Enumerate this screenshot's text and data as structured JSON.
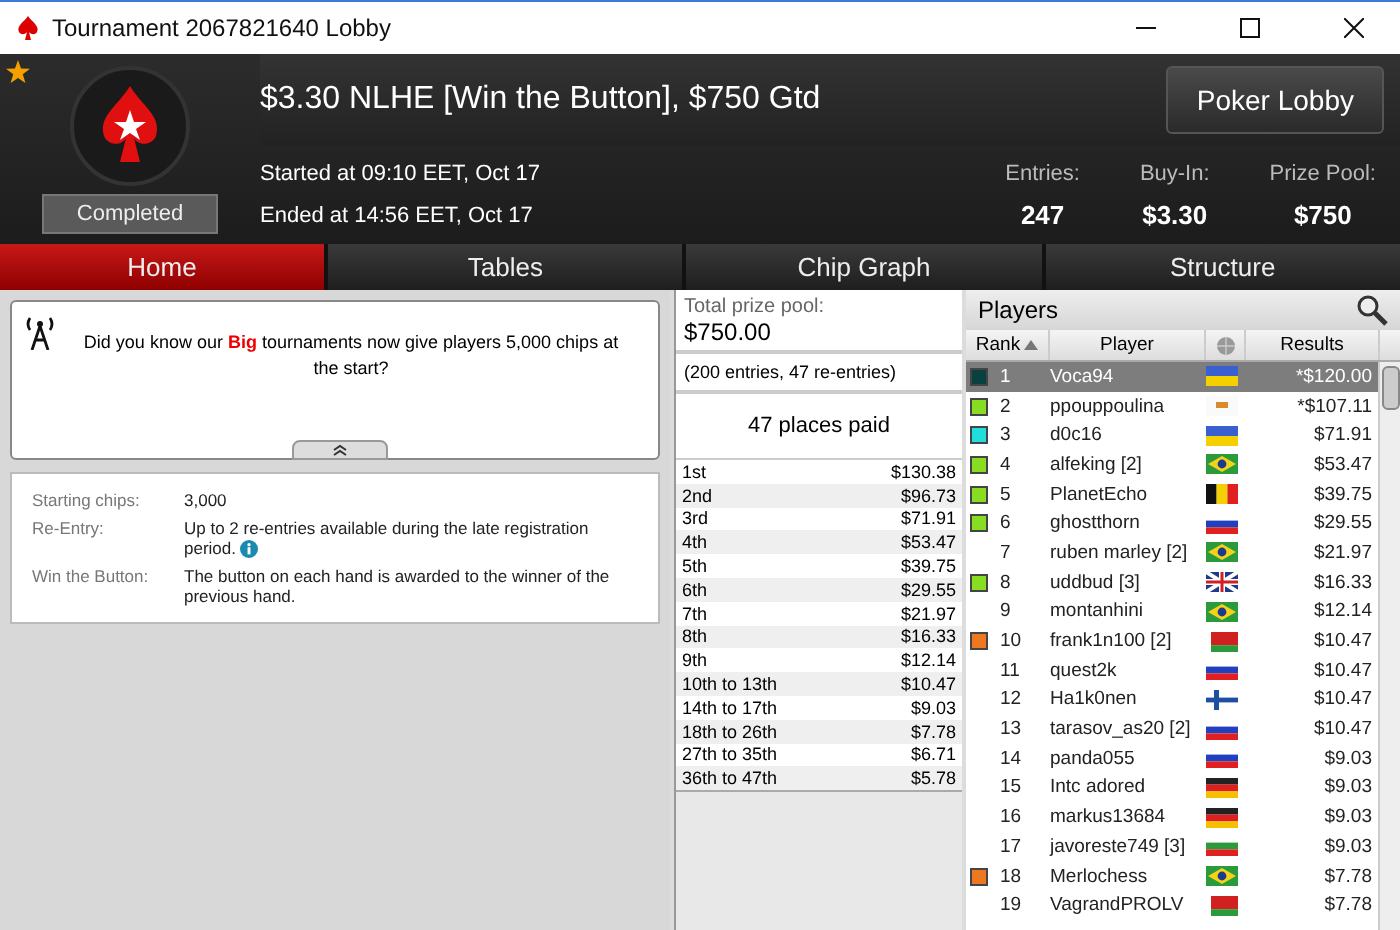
{
  "window": {
    "title": "Tournament 2067821640 Lobby"
  },
  "header": {
    "favorite": true,
    "title": "$3.30 NLHE [Win the Button], $750 Gtd",
    "status": "Completed",
    "started": "Started at 09:10 EET, Oct 17",
    "ended": "Ended at 14:56 EET, Oct 17",
    "stats": [
      {
        "label": "Entries:",
        "value": "247"
      },
      {
        "label": "Buy-In:",
        "value": "$3.30"
      },
      {
        "label": "Prize Pool:",
        "value": "$750"
      }
    ],
    "lobby_button": "Poker Lobby"
  },
  "tabs": [
    {
      "label": "Home",
      "selected": true
    },
    {
      "label": "Tables",
      "selected": false
    },
    {
      "label": "Chip Graph",
      "selected": false
    },
    {
      "label": "Structure",
      "selected": false
    }
  ],
  "news": "Did you know our **Big** tournaments now give players 5,000 chips at the start?",
  "details": [
    {
      "label": "Starting chips:",
      "value": "3,000",
      "info": false
    },
    {
      "label": "Re-Entry:",
      "value": "Up to 2 re-entries available during the late registration period.",
      "info": true
    },
    {
      "label": "Win the Button:",
      "value": "The button on each hand is awarded to the winner of the previous hand.",
      "info": false
    }
  ],
  "prize": {
    "label": "Total prize pool:",
    "total": "$750.00",
    "entries": "(200 entries, 47 re-entries)",
    "paid": "47 places paid",
    "places": [
      {
        "place": "1st",
        "amount": "$130.38"
      },
      {
        "place": "2nd",
        "amount": "$96.73"
      },
      {
        "place": "3rd",
        "amount": "$71.91"
      },
      {
        "place": "4th",
        "amount": "$53.47"
      },
      {
        "place": "5th",
        "amount": "$39.75"
      },
      {
        "place": "6th",
        "amount": "$29.55"
      },
      {
        "place": "7th",
        "amount": "$21.97"
      },
      {
        "place": "8th",
        "amount": "$16.33"
      },
      {
        "place": "9th",
        "amount": "$12.14"
      },
      {
        "place": "10th to 13th",
        "amount": "$10.47"
      },
      {
        "place": "14th to 17th",
        "amount": "$9.03"
      },
      {
        "place": "18th to 26th",
        "amount": "$7.78"
      },
      {
        "place": "27th to 35th",
        "amount": "$6.71"
      },
      {
        "place": "36th to 47th",
        "amount": "$5.78"
      }
    ]
  },
  "players": {
    "title": "Players",
    "columns": [
      "Rank",
      "Player",
      "Results"
    ],
    "rows": [
      {
        "rank": "1",
        "name": "Voca94",
        "kind": "ukraine",
        "result": "*$120.00",
        "color": "#0b4040",
        "selected": true
      },
      {
        "rank": "2",
        "name": "ppouppoulina",
        "kind": "cyprus",
        "result": "*$107.11",
        "color": "#88dd22",
        "selected": false
      },
      {
        "rank": "3",
        "name": "d0c16",
        "kind": "ukraine",
        "result": "$71.91",
        "color": "#22dddd",
        "selected": false
      },
      {
        "rank": "4",
        "name": "alfeking [2]",
        "kind": "brazil",
        "result": "$53.47",
        "color": "#88dd22",
        "selected": false
      },
      {
        "rank": "5",
        "name": "PlanetEcho",
        "kind": "belgium",
        "result": "$39.75",
        "color": "#88dd22",
        "selected": false
      },
      {
        "rank": "6",
        "name": "ghostthorn",
        "kind": "russia",
        "result": "$29.55",
        "color": "#88dd22",
        "selected": false
      },
      {
        "rank": "7",
        "name": "ruben marley [2]",
        "kind": "brazil",
        "result": "$21.97",
        "selected": false
      },
      {
        "rank": "8",
        "name": "uddbud [3]",
        "kind": "uk",
        "result": "$16.33",
        "color": "#88dd22",
        "selected": false
      },
      {
        "rank": "9",
        "name": "montanhini",
        "kind": "brazil",
        "result": "$12.14",
        "selected": false
      },
      {
        "rank": "10",
        "name": "frank1n100 [2]",
        "kind": "belarus",
        "result": "$10.47",
        "color": "#ee7722",
        "selected": false
      },
      {
        "rank": "11",
        "name": "quest2k",
        "kind": "russia",
        "result": "$10.47",
        "selected": false
      },
      {
        "rank": "12",
        "name": "Ha1k0nen",
        "kind": "finland",
        "result": "$10.47",
        "selected": false
      },
      {
        "rank": "13",
        "name": "tarasov_as20 [2]",
        "kind": "russia",
        "result": "$10.47",
        "selected": false
      },
      {
        "rank": "14",
        "name": "panda055",
        "kind": "russia",
        "result": "$9.03",
        "selected": false
      },
      {
        "rank": "15",
        "name": "Intc adored",
        "kind": "germany",
        "result": "$9.03",
        "selected": false
      },
      {
        "rank": "16",
        "name": "markus13684",
        "kind": "germany",
        "result": "$9.03",
        "selected": false
      },
      {
        "rank": "17",
        "name": "javoreste749 [3]",
        "kind": "bulgaria",
        "result": "$9.03",
        "selected": false
      },
      {
        "rank": "18",
        "name": "Merlochess",
        "kind": "brazil",
        "result": "$7.78",
        "color": "#ee7722",
        "selected": false
      },
      {
        "rank": "19",
        "name": "VagrandPROLV",
        "kind": "belarus",
        "result": "$7.78",
        "selected": false
      }
    ]
  }
}
